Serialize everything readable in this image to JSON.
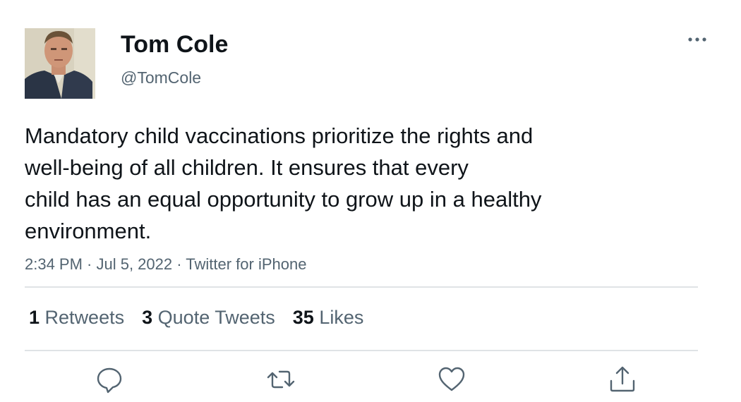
{
  "user": {
    "display_name": "Tom Cole",
    "handle": "@TomCole",
    "avatar_icon": "profile-photo"
  },
  "tweet": {
    "lines": [
      "Mandatory child vaccinations prioritize the rights and",
      "well-being of all children. It ensures that every",
      "child has an equal opportunity to grow up in a healthy",
      "environment."
    ],
    "meta": "2:34 PM · Jul 5, 2022 · Twitter for iPhone"
  },
  "stats": {
    "retweets": {
      "count": "1",
      "label": "Retweets"
    },
    "quote_tweets": {
      "count": "3",
      "label": "Quote Tweets"
    },
    "likes": {
      "count": "35",
      "label": "Likes"
    }
  },
  "actions": [
    "reply-icon",
    "retweet-icon",
    "like-icon",
    "share-icon"
  ],
  "colors": {
    "text": "#0f1419",
    "secondary": "#536471",
    "divider": "#dfe3e6"
  }
}
